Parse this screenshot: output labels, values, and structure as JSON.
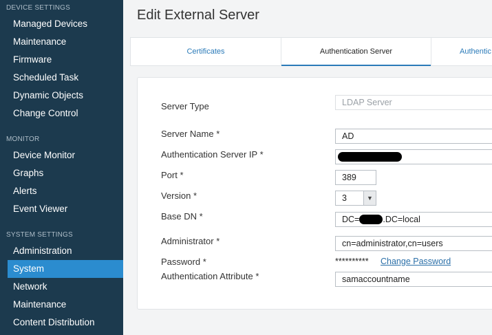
{
  "sidebar": {
    "sections": [
      {
        "heading": "DEVICE SETTINGS",
        "items": [
          "Managed Devices",
          "Maintenance",
          "Firmware",
          "Scheduled Task",
          "Dynamic Objects",
          "Change Control"
        ]
      },
      {
        "heading": "MONITOR",
        "items": [
          "Device Monitor",
          "Graphs",
          "Alerts",
          "Event Viewer"
        ]
      },
      {
        "heading": "SYSTEM SETTINGS",
        "items": [
          "Administration",
          "System",
          "Network",
          "Maintenance",
          "Content Distribution"
        ]
      }
    ],
    "active_item": "System"
  },
  "main": {
    "title": "Edit External Server",
    "tabs": [
      {
        "label": "Certificates",
        "active": false
      },
      {
        "label": "Authentication Server",
        "active": true
      },
      {
        "label": "Authentic",
        "active": false
      }
    ]
  },
  "form": {
    "server_type": {
      "label": "Server Type",
      "value": "LDAP Server"
    },
    "server_name": {
      "label": "Server Name *",
      "value": "AD"
    },
    "auth_server_ip": {
      "label": "Authentication Server IP *",
      "value": ""
    },
    "port": {
      "label": "Port *",
      "value": "389"
    },
    "version": {
      "label": "Version *",
      "value": "3"
    },
    "base_dn": {
      "label": "Base DN *",
      "prefix": "DC=",
      "suffix": ".DC=local"
    },
    "administrator": {
      "label": "Administrator *",
      "value": "cn=administrator,cn=users"
    },
    "password": {
      "label": "Password *",
      "mask": "**********",
      "link": "Change Password"
    },
    "auth_attribute": {
      "label": "Authentication Attribute *",
      "value": "samaccountname"
    }
  },
  "colors": {
    "sidebar_bg": "#1c3a4e",
    "active_item_bg": "#2b8ccf",
    "accent": "#2a7ab8"
  }
}
